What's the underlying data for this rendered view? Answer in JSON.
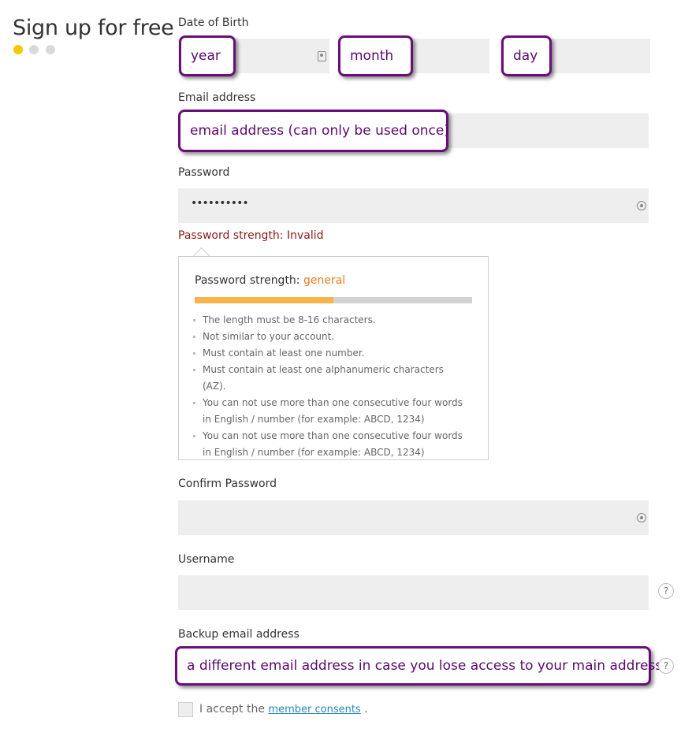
{
  "header": {
    "title": "Sign up for free",
    "steps": [
      {
        "state": "active"
      },
      {
        "state": "inactive"
      },
      {
        "state": "inactive"
      }
    ]
  },
  "form": {
    "dob": {
      "label": "Date of Birth",
      "year_callout": "year",
      "month_callout": "month",
      "day_callout": "day"
    },
    "email": {
      "label": "Email address",
      "callout": "email address (can only be used once)"
    },
    "password": {
      "label": "Password",
      "value": "••••••••••",
      "strength_line": "Password strength: Invalid",
      "popup": {
        "heading": "Password strength: ",
        "level": "general",
        "strength_fraction": 0.5,
        "rules": [
          "The length must be 8-16 characters.",
          "Not similar to your account.",
          "Must contain at least one number.",
          "Must contain at least one alphanumeric characters (AZ).",
          "You can not use more than one consecutive four words in English / number (for example: ABCD, 1234)",
          "You can not use more than one consecutive four words in English / number (for example: ABCD, 1234)"
        ]
      }
    },
    "confirm_password": {
      "label": "Confirm Password"
    },
    "username": {
      "label": "Username",
      "help": "?"
    },
    "backup_email": {
      "label": "Backup email address",
      "callout": "a different email address in case you lose access to your main address",
      "help": "?"
    },
    "consent": {
      "prefix": "I accept the ",
      "link": "member consents",
      "suffix": " ."
    }
  },
  "colors": {
    "accent_dot": "#f5c800",
    "callout_border": "#6a0f7a",
    "strength_bar": "#f9b449",
    "invalid_text": "#8b1a1a"
  }
}
